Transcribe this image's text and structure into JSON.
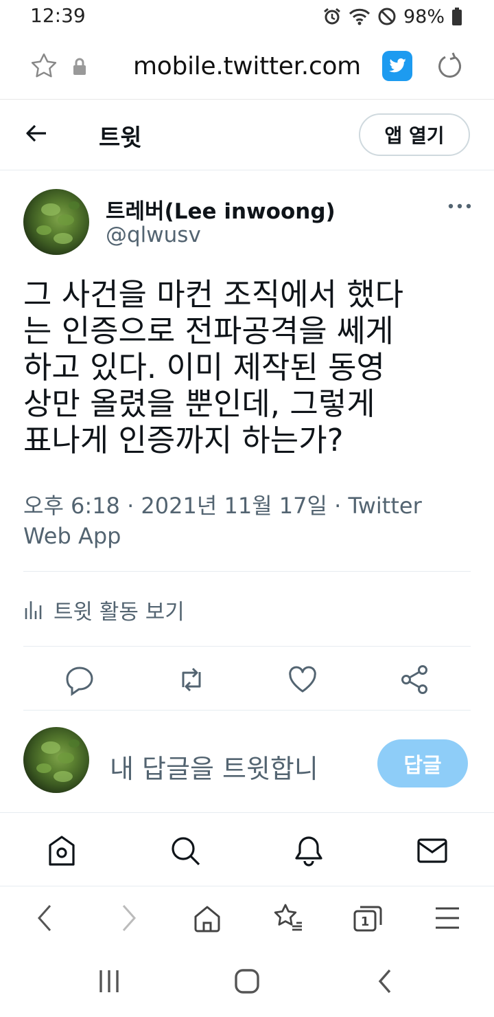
{
  "status_bar": {
    "time": "12:39",
    "battery": "98%"
  },
  "browser": {
    "url": "mobile.twitter.com"
  },
  "header": {
    "title": "트윗",
    "open_app": "앱 열기"
  },
  "tweet": {
    "author_name": "트레버(Lee inwoong)",
    "author_handle": "@qlwusv",
    "text": "그 사건을 마컨 조직에서 했다\n는 인증으로 전파공격을 쎄게\n하고 있다. 이미 제작된 동영\n상만 올렸을 뿐인데, 그렇게\n표나게 인증까지 하는가?",
    "meta_line1": "오후 6:18 · 2021년 11월 17일 · Twitter",
    "meta_line2": "Web App",
    "activity_label": "트윗 활동 보기"
  },
  "reply": {
    "placeholder": "내 답글을 트윗합니",
    "button": "답글"
  },
  "colors": {
    "accent": "#1d9bf0",
    "reply_button": "#8ecdf8",
    "secondary_text": "#536471"
  },
  "icons": {
    "status": [
      "alarm-icon",
      "wifi-icon",
      "do-not-disturb-icon",
      "battery-icon"
    ],
    "browser_top": [
      "star-icon",
      "lock-icon",
      "twitter-icon",
      "refresh-icon"
    ],
    "tweet_actions": [
      "reply-icon",
      "retweet-icon",
      "like-icon",
      "share-icon"
    ],
    "twitter_nav": [
      "home-icon",
      "search-icon",
      "notifications-icon",
      "messages-icon"
    ],
    "browser_nav": [
      "back-icon",
      "forward-icon",
      "browser-home-icon",
      "bookmarks-icon",
      "tabs-icon",
      "menu-icon"
    ],
    "tab_count": "1",
    "system_nav": [
      "recents-icon",
      "home-circle-icon",
      "system-back-icon"
    ]
  }
}
